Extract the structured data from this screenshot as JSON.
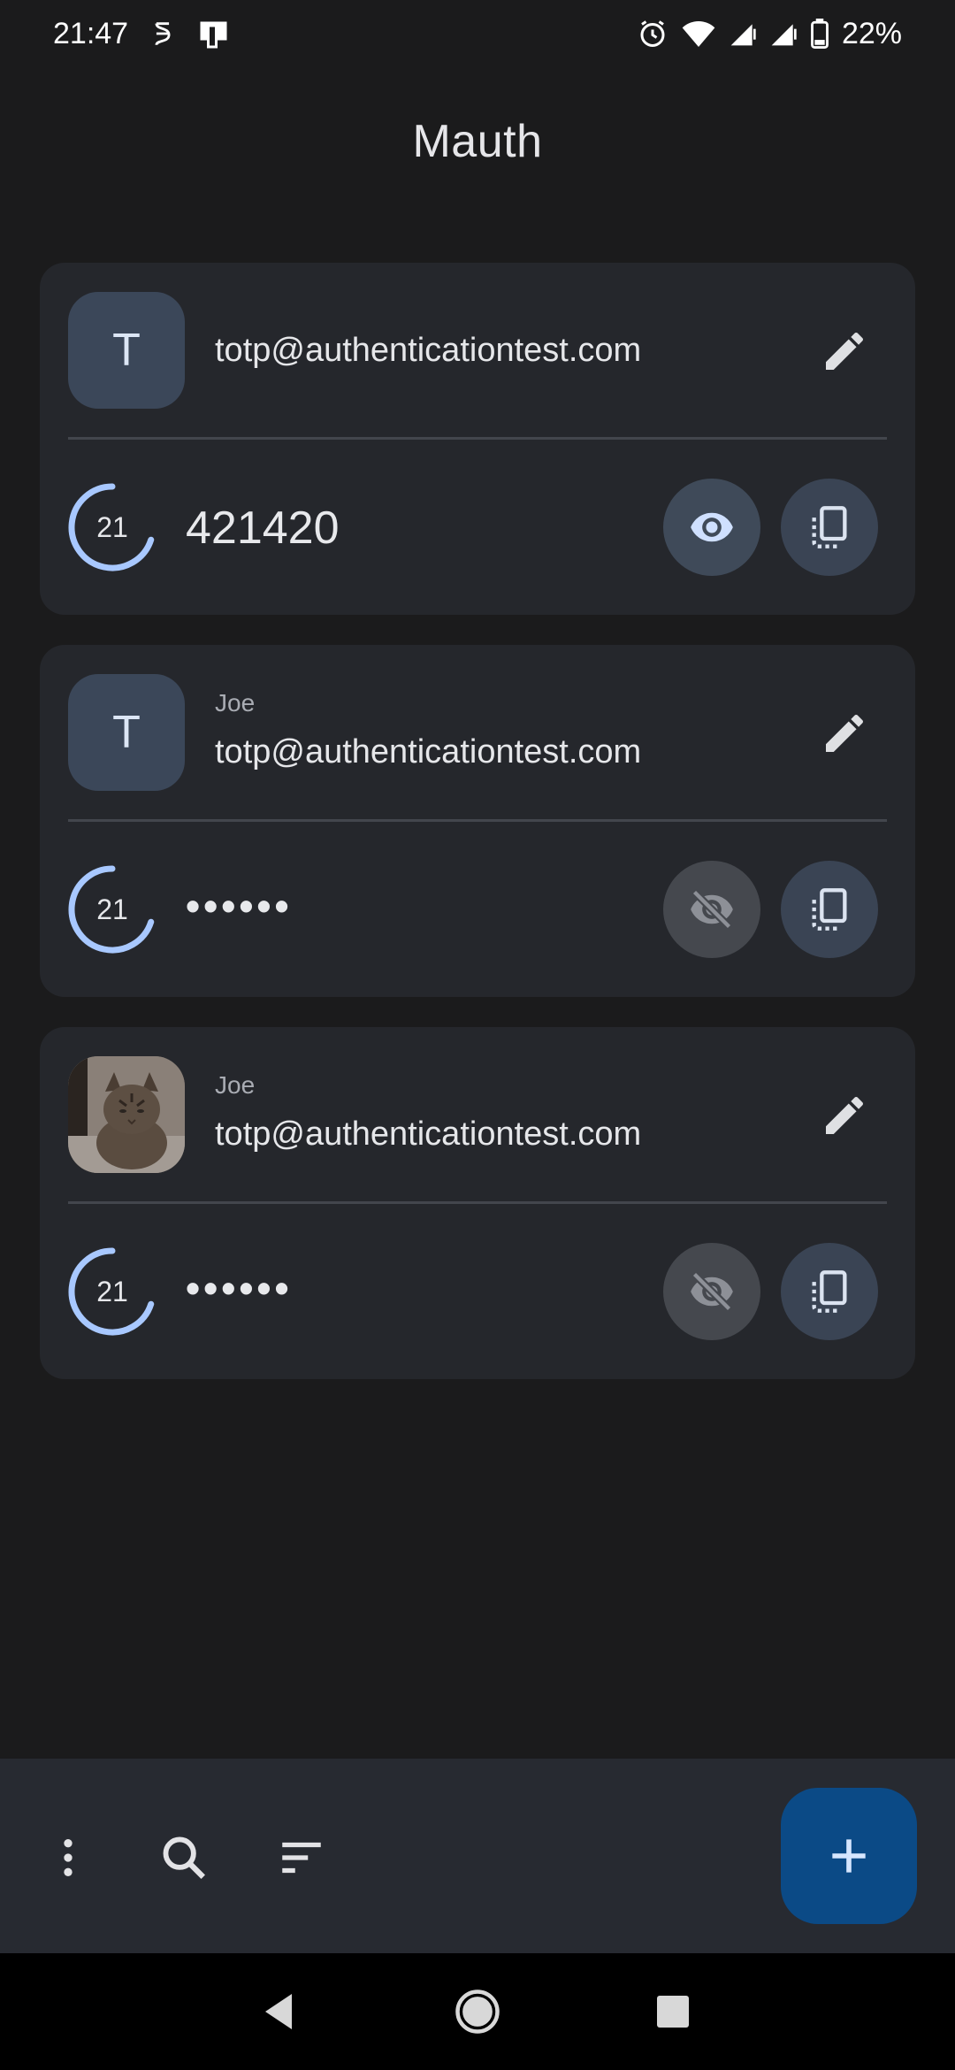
{
  "status_bar": {
    "time": "21:47",
    "battery": "22%",
    "icons": [
      "notification-icon",
      "device-icon",
      "alarm-icon",
      "wifi-icon",
      "signal-icon",
      "signal-icon",
      "battery-icon"
    ]
  },
  "app": {
    "title": "Mauth"
  },
  "accounts": [
    {
      "avatar_letter": "T",
      "issuer": "",
      "account": "totp@authenticationtest.com",
      "timer": "21",
      "timer_fraction": 0.7,
      "code": "421420",
      "code_visible": true
    },
    {
      "avatar_letter": "T",
      "issuer": "Joe",
      "account": "totp@authenticationtest.com",
      "timer": "21",
      "timer_fraction": 0.7,
      "code": "••••••",
      "code_visible": false
    },
    {
      "avatar_letter": "",
      "avatar_image": "cat-photo",
      "issuer": "Joe",
      "account": "totp@authenticationtest.com",
      "timer": "21",
      "timer_fraction": 0.7,
      "code": "••••••",
      "code_visible": false
    }
  ],
  "bottom_bar": {
    "icons": [
      "more-vert-icon",
      "search-icon",
      "sort-icon"
    ],
    "fab_icon": "add-icon"
  },
  "colors": {
    "background": "#1b1b1c",
    "card": "#25272c",
    "accent": "#a8c8ff",
    "fab": "#0b4a86"
  }
}
